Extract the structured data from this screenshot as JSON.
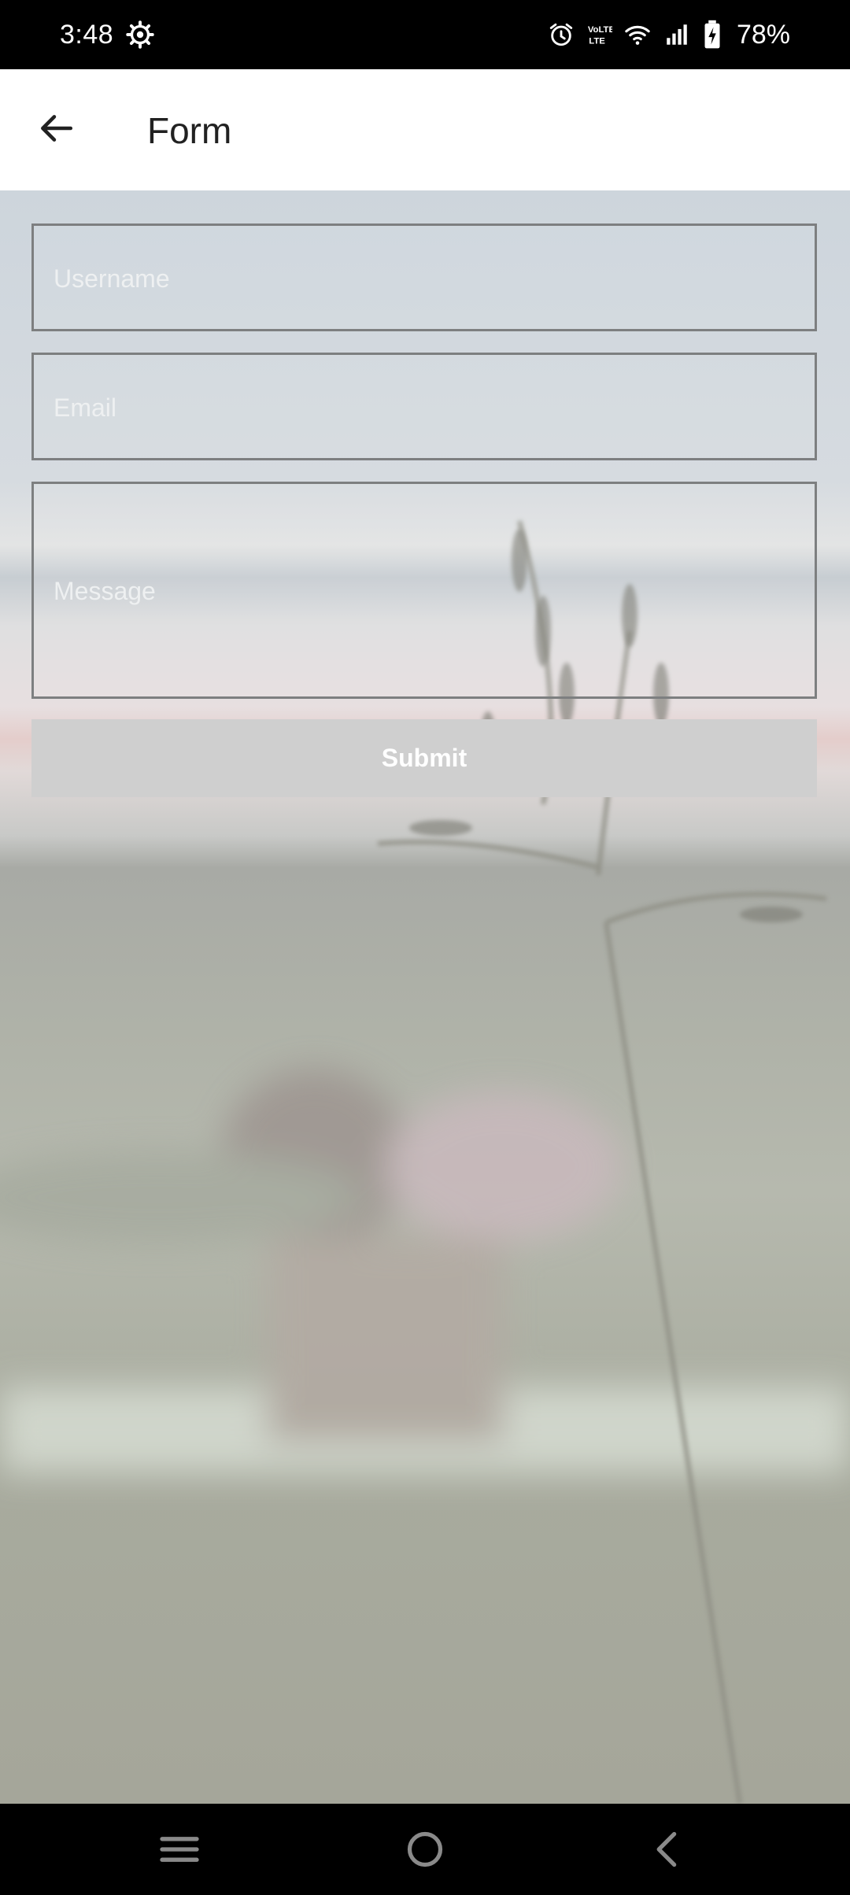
{
  "status_bar": {
    "time": "3:48",
    "battery_percent": "78%",
    "icons": [
      "gear-icon",
      "alarm-icon",
      "volte-icon",
      "wifi-icon",
      "signal-icon",
      "battery-charging-icon"
    ]
  },
  "app_bar": {
    "title": "Form",
    "back_icon": "arrow-left-icon"
  },
  "form": {
    "username": {
      "placeholder": "Username",
      "value": ""
    },
    "email": {
      "placeholder": "Email",
      "value": ""
    },
    "message": {
      "placeholder": "Message",
      "value": ""
    },
    "submit_label": "Submit"
  },
  "nav_bar": {
    "items": [
      "menu-icon",
      "home-icon",
      "back-icon"
    ]
  },
  "colors": {
    "app_bar_bg": "#ffffff",
    "submit_bg": "#cfcfcf",
    "field_border": "#7d7f80",
    "system_bar_bg": "#000000"
  }
}
